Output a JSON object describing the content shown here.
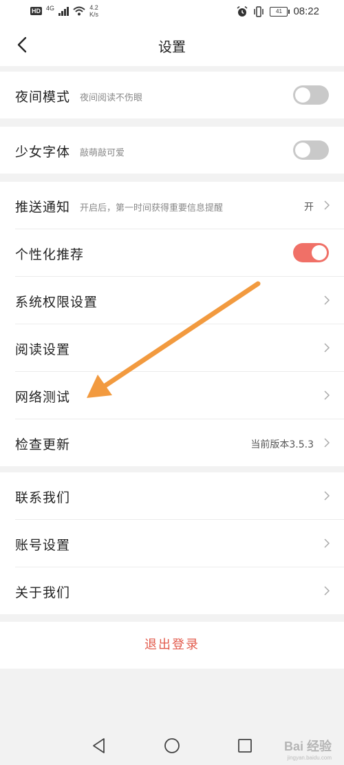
{
  "status_bar": {
    "hd": "HD",
    "signal": "4G",
    "speed_value": "4.2",
    "speed_unit": "K/s",
    "battery": "41",
    "time": "08:22"
  },
  "header": {
    "title": "设置"
  },
  "groups": {
    "g1": {
      "night_mode_label": "夜间模式",
      "night_mode_sub": "夜间阅读不伤眼"
    },
    "g2": {
      "girl_font_label": "少女字体",
      "girl_font_sub": "敲萌敲可爱"
    },
    "g3": {
      "push_label": "推送通知",
      "push_sub": "开启后，第一时间获得重要信息提醒",
      "push_value": "开",
      "personal_label": "个性化推荐",
      "permission_label": "系统权限设置",
      "reading_label": "阅读设置",
      "network_label": "网络测试",
      "update_label": "检查更新",
      "update_value": "当前版本3.5.3"
    },
    "g4": {
      "contact_label": "联系我们",
      "account_label": "账号设置",
      "about_label": "关于我们"
    }
  },
  "logout_label": "退出登录",
  "toggles": {
    "night_mode": false,
    "girl_font": false,
    "personalized": true
  },
  "colors": {
    "accent": "#f07067",
    "logout": "#e25a4b",
    "annotation_arrow": "#f29a3f"
  },
  "watermark": {
    "main": "Bai 经验",
    "sub": "jingyan.baidu.com"
  }
}
